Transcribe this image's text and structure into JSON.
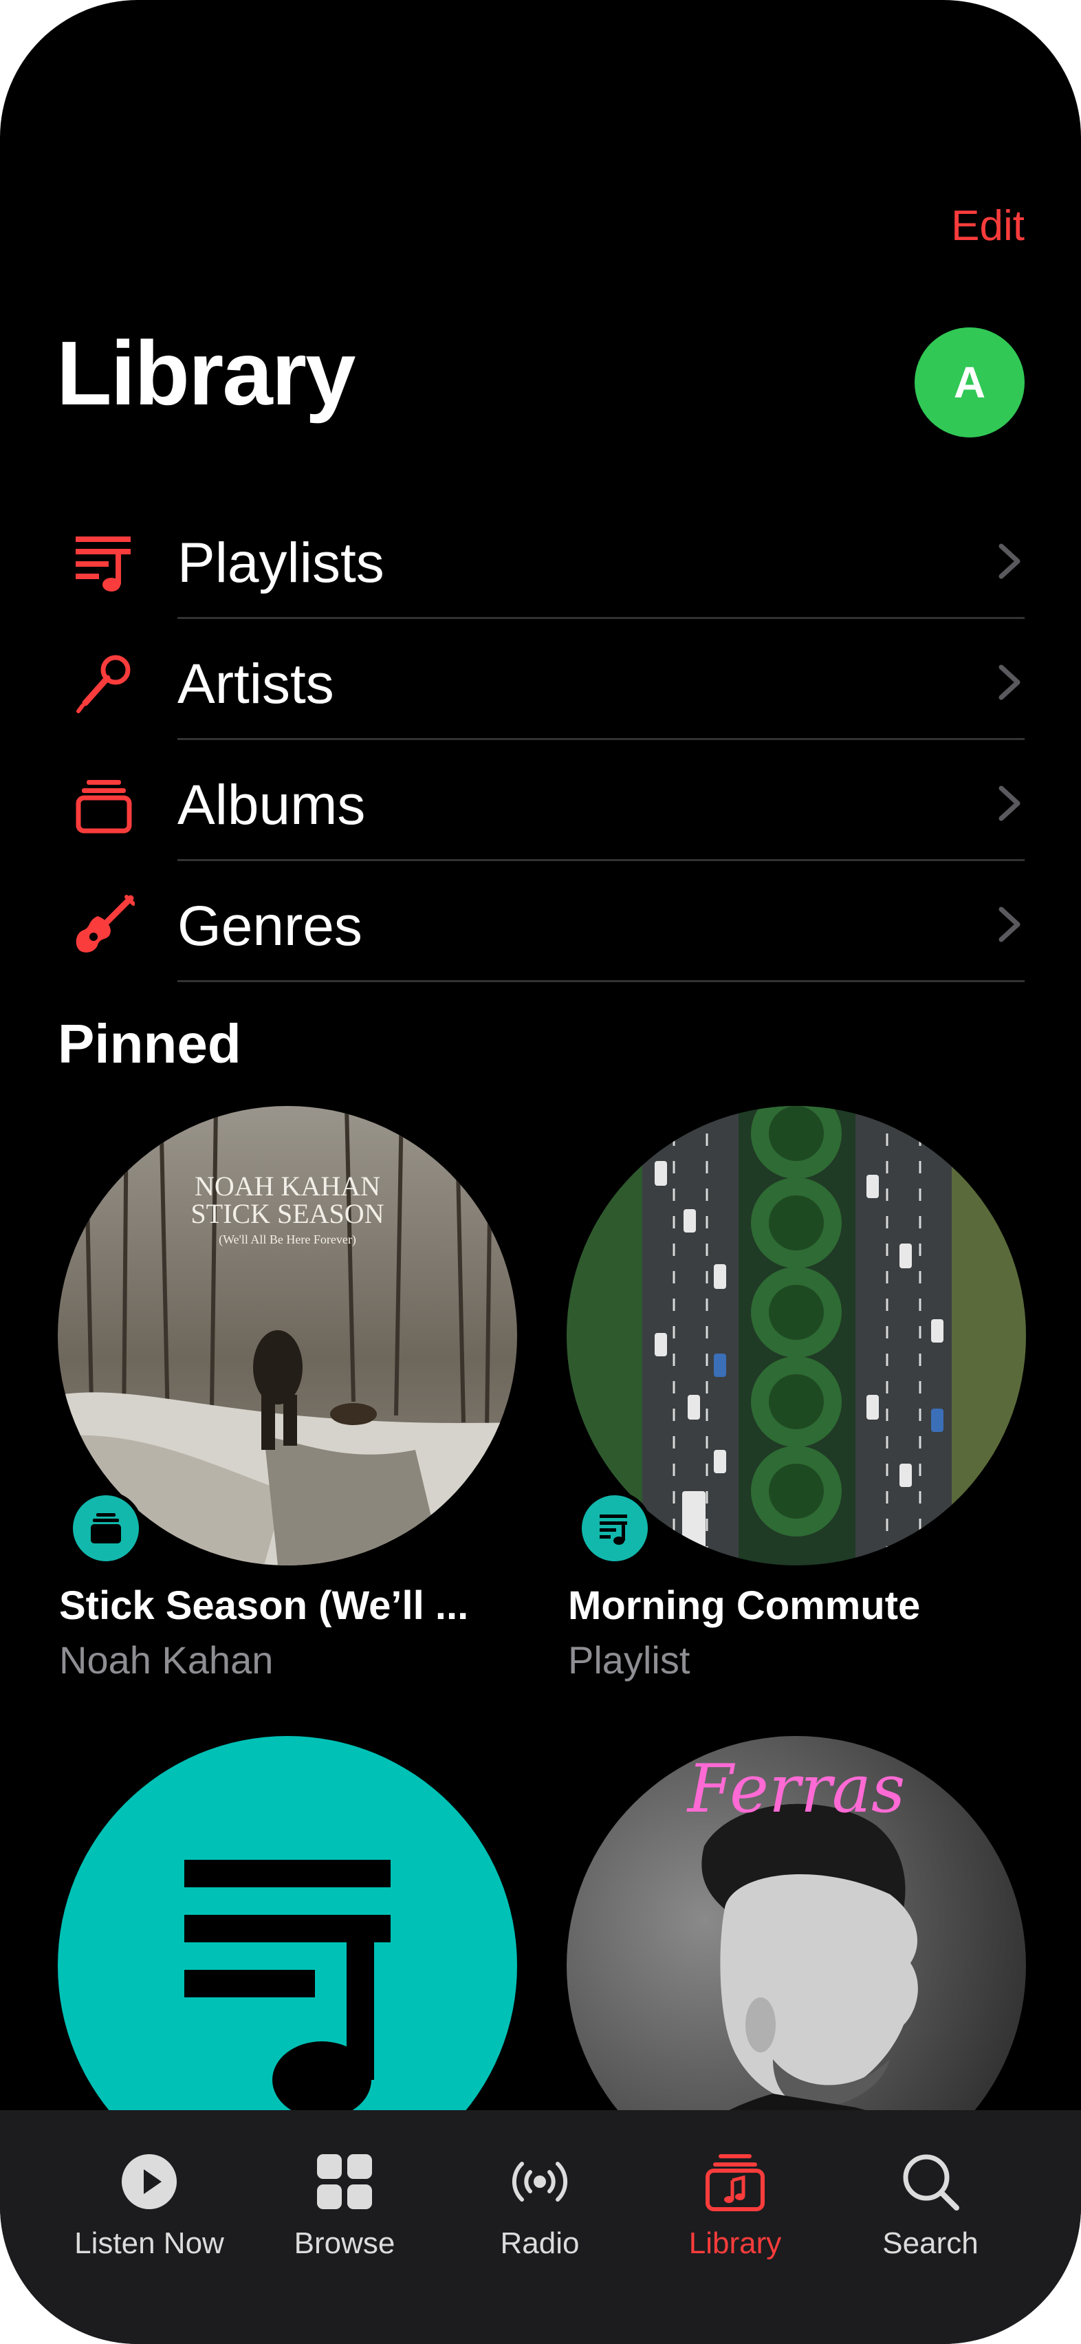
{
  "header": {
    "edit_label": "Edit",
    "title": "Library",
    "avatar_initial": "A"
  },
  "menu": {
    "items": [
      {
        "label": "Playlists",
        "icon": "playlist-icon"
      },
      {
        "label": "Artists",
        "icon": "microphone-icon"
      },
      {
        "label": "Albums",
        "icon": "album-stack-icon"
      },
      {
        "label": "Genres",
        "icon": "guitar-icon"
      }
    ]
  },
  "pinned": {
    "heading": "Pinned",
    "cards": [
      {
        "cover_text_line1": "NOAH KAHAN",
        "cover_text_line2": "STICK SEASON",
        "cover_text_line3": "(We'll All Be Here Forever)",
        "title": "Stick Season (We’ll ...",
        "subtitle": "Noah Kahan",
        "badge_icon": "album-stack-icon"
      },
      {
        "title": "Morning Commute",
        "subtitle": "Playlist",
        "badge_icon": "playlist-icon"
      },
      {
        "art_icon": "playlist-icon"
      },
      {
        "cover_text": "Ferras"
      }
    ]
  },
  "tabs": [
    {
      "label": "Listen Now",
      "icon": "play-circle-icon"
    },
    {
      "label": "Browse",
      "icon": "grid-icon"
    },
    {
      "label": "Radio",
      "icon": "radio-waves-icon"
    },
    {
      "label": "Library",
      "icon": "library-music-icon",
      "active": true
    },
    {
      "label": "Search",
      "icon": "search-icon"
    }
  ],
  "colors": {
    "accent": "#fa3c3c",
    "avatar": "#31c856",
    "teal": "#12b8ac",
    "background": "#000000",
    "tabbar": "#1c1c1e",
    "secondary_text": "#8e8e93"
  }
}
